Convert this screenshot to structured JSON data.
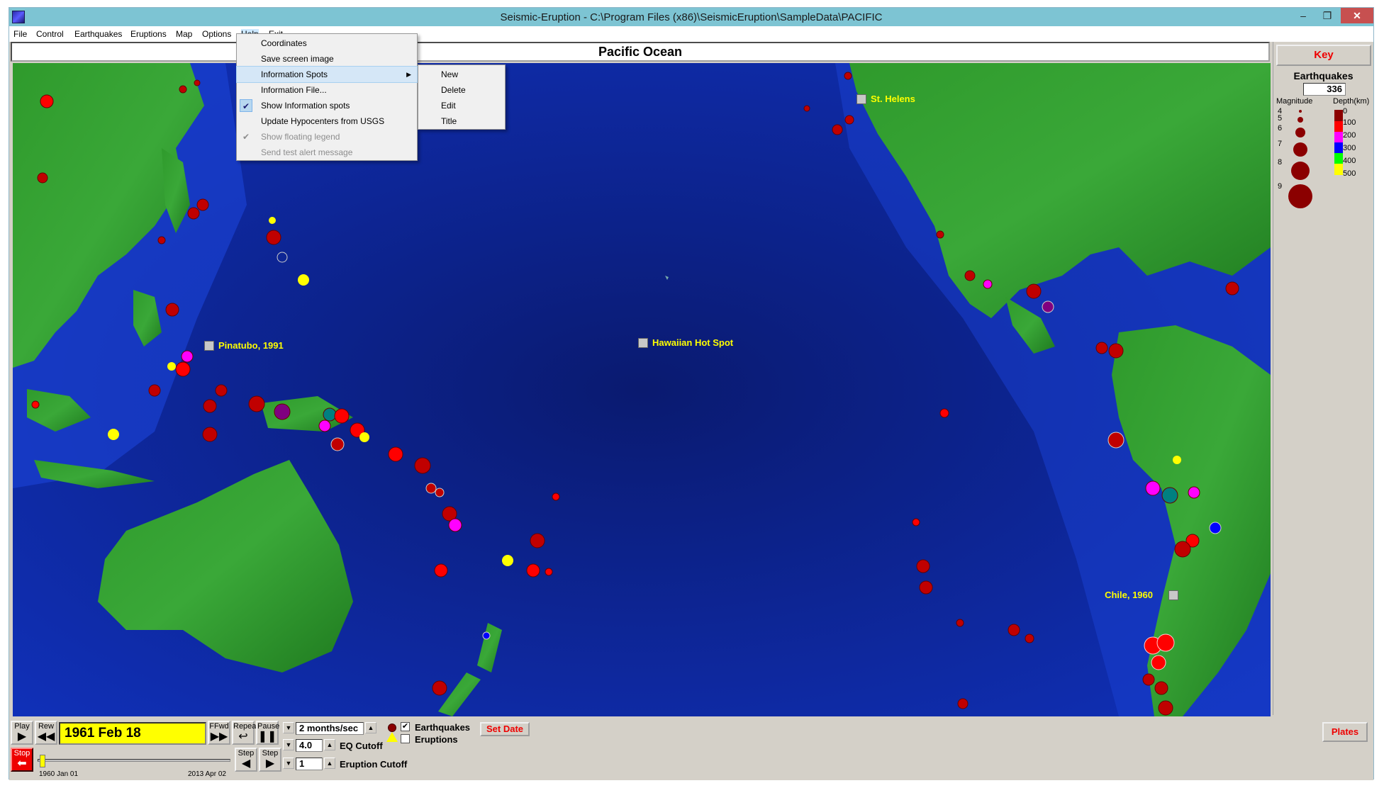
{
  "window": {
    "title": "Seismic-Eruption - C:\\Program Files (x86)\\SeismicEruption\\SampleData\\PACIFIC",
    "min_glyph": "–",
    "max_glyph": "❐",
    "close_glyph": "✕"
  },
  "menubar": [
    "File",
    "Control",
    "Earthquakes",
    "Eruptions",
    "Map",
    "Options",
    "Help",
    "Exit"
  ],
  "dropdown": {
    "items": [
      {
        "label": "Coordinates",
        "checked": false,
        "disabled": false,
        "submenu": false
      },
      {
        "label": "Save screen image",
        "checked": false,
        "disabled": false,
        "submenu": false
      },
      {
        "label": "Information Spots",
        "checked": false,
        "disabled": false,
        "submenu": true
      },
      {
        "label": "Information File...",
        "checked": false,
        "disabled": false,
        "submenu": false
      },
      {
        "label": "Show Information spots",
        "checked": true,
        "disabled": false,
        "submenu": false
      },
      {
        "label": "Update Hypocenters from USGS",
        "checked": false,
        "disabled": false,
        "submenu": false
      },
      {
        "label": "Show floating legend",
        "checked": true,
        "disabled": true,
        "submenu": false
      },
      {
        "label": "Send test alert message",
        "checked": false,
        "disabled": true,
        "submenu": false
      }
    ],
    "submenu_items": [
      "New",
      "Delete",
      "Edit",
      "Title"
    ]
  },
  "region_title": "Pacific Ocean",
  "info_spots": [
    {
      "label": "St. Helens"
    },
    {
      "label": "Pinatubo, 1991"
    },
    {
      "label": "Hawaiian Hot Spot"
    },
    {
      "label": "Chile, 1960"
    }
  ],
  "key": {
    "button_label": "Key",
    "heading": "Earthquakes",
    "count": "336",
    "magnitude_label": "Magnitude",
    "depth_label": "Depth(km)",
    "magnitudes": [
      "4",
      "5",
      "6",
      "7",
      "8",
      "9"
    ],
    "depths": [
      {
        "value": "0",
        "color": "#8b0000"
      },
      {
        "value": "100",
        "color": "#ff0000"
      },
      {
        "value": "200",
        "color": "#ff00ff"
      },
      {
        "value": "300",
        "color": "#0000ff"
      },
      {
        "value": "400",
        "color": "#00ff00"
      },
      {
        "value": "500",
        "color": "#ffff00"
      }
    ]
  },
  "controls": {
    "play": "Play",
    "rew": "Rew",
    "ffwd": "FFwd",
    "repeat": "Repeat",
    "pause": "Pause",
    "date": "1961 Feb 18",
    "speed": "2 months/sec",
    "eq_cutoff_value": "4.0",
    "eq_cutoff_label": "EQ Cutoff",
    "eruption_cutoff_value": "1",
    "eruption_cutoff_label": "Eruption Cutoff",
    "earthquakes_label": "Earthquakes",
    "earthquakes_checked": true,
    "eruptions_label": "Eruptions",
    "eruptions_checked": false,
    "set_date": "Set Date",
    "plates": "Plates",
    "step": "Step",
    "stop": "Stop",
    "start_date": "1960 Jan 01",
    "end_date": "2013 Apr 02",
    "slider_position": 0.01
  },
  "colors": {
    "ocean": "#0a1a7a",
    "land": "#2d8a2a",
    "quake_shallow": "#c00000",
    "quake_mid": "#ff0000",
    "quake_deep": "#ff00ff",
    "eruption": "#ffff00"
  }
}
